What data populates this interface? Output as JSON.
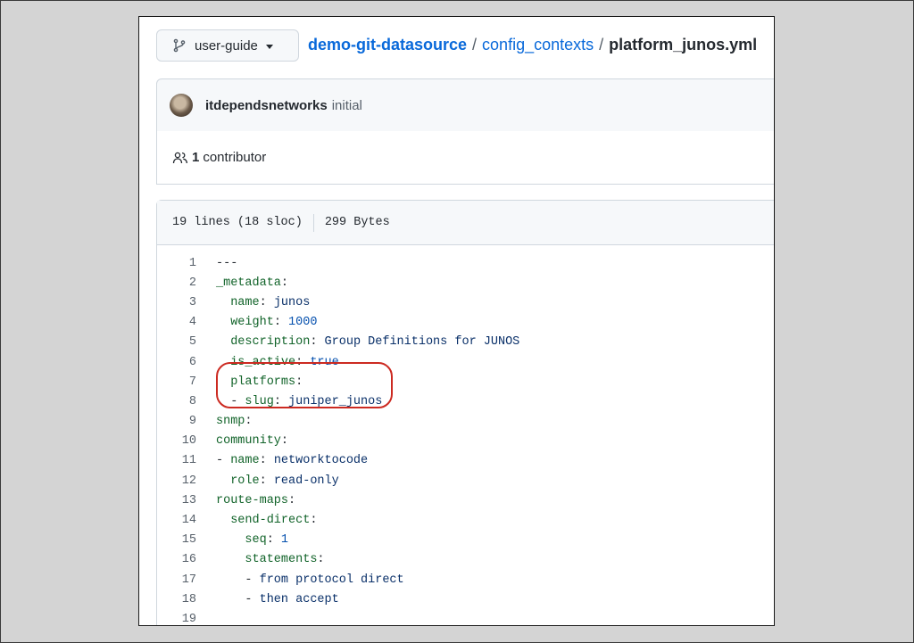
{
  "branch": {
    "label": "user-guide"
  },
  "breadcrumb": {
    "repo": "demo-git-datasource",
    "sep1": "/",
    "folder": "config_contexts",
    "sep2": "/",
    "file": "platform_junos.yml"
  },
  "commit": {
    "author": "itdependsnetworks",
    "message": "initial"
  },
  "contributors": {
    "count": "1",
    "label": "contributor"
  },
  "file_info": {
    "lines": "19 lines (18 sloc)",
    "size": "299 Bytes"
  },
  "code": {
    "lines": [
      {
        "num": "1",
        "indent": "",
        "key": "",
        "colon": "",
        "value": "---",
        "vtype": "p",
        "dash": ""
      },
      {
        "num": "2",
        "indent": "",
        "key": "_metadata",
        "colon": ":",
        "value": "",
        "vtype": "v",
        "dash": ""
      },
      {
        "num": "3",
        "indent": "  ",
        "key": "name",
        "colon": ":",
        "value": " junos",
        "vtype": "v",
        "dash": ""
      },
      {
        "num": "4",
        "indent": "  ",
        "key": "weight",
        "colon": ":",
        "value": " 1000",
        "vtype": "n",
        "dash": ""
      },
      {
        "num": "5",
        "indent": "  ",
        "key": "description",
        "colon": ":",
        "value": " Group Definitions for JUNOS",
        "vtype": "v",
        "dash": ""
      },
      {
        "num": "6",
        "indent": "  ",
        "key": "is_active",
        "colon": ":",
        "value": " true",
        "vtype": "n",
        "dash": ""
      },
      {
        "num": "7",
        "indent": "  ",
        "key": "platforms",
        "colon": ":",
        "value": "",
        "vtype": "v",
        "dash": ""
      },
      {
        "num": "8",
        "indent": "  ",
        "key": "slug",
        "colon": ":",
        "value": " juniper_junos",
        "vtype": "v",
        "dash": "- "
      },
      {
        "num": "9",
        "indent": "",
        "key": "snmp",
        "colon": ":",
        "value": "",
        "vtype": "v",
        "dash": ""
      },
      {
        "num": "10",
        "indent": "",
        "key": "community",
        "colon": ":",
        "value": "",
        "vtype": "v",
        "dash": ""
      },
      {
        "num": "11",
        "indent": "",
        "key": "name",
        "colon": ":",
        "value": " networktocode",
        "vtype": "v",
        "dash": "- "
      },
      {
        "num": "12",
        "indent": "  ",
        "key": "role",
        "colon": ":",
        "value": " read-only",
        "vtype": "v",
        "dash": ""
      },
      {
        "num": "13",
        "indent": "",
        "key": "route-maps",
        "colon": ":",
        "value": "",
        "vtype": "v",
        "dash": ""
      },
      {
        "num": "14",
        "indent": "  ",
        "key": "send-direct",
        "colon": ":",
        "value": "",
        "vtype": "v",
        "dash": ""
      },
      {
        "num": "15",
        "indent": "    ",
        "key": "seq",
        "colon": ":",
        "value": " 1",
        "vtype": "n",
        "dash": ""
      },
      {
        "num": "16",
        "indent": "    ",
        "key": "statements",
        "colon": ":",
        "value": "",
        "vtype": "v",
        "dash": ""
      },
      {
        "num": "17",
        "indent": "    ",
        "key": "",
        "colon": "",
        "value": "from protocol direct",
        "vtype": "v",
        "dash": "- "
      },
      {
        "num": "18",
        "indent": "    ",
        "key": "",
        "colon": "",
        "value": "then accept",
        "vtype": "v",
        "dash": "- "
      },
      {
        "num": "19",
        "indent": "",
        "key": "",
        "colon": "",
        "value": "",
        "vtype": "v",
        "dash": ""
      }
    ]
  },
  "colors": {
    "link": "#0969da",
    "yaml_key": "#116329",
    "yaml_string": "#0a3069",
    "yaml_number": "#0550ae",
    "annotation_ring": "#cc2a21"
  },
  "icons": {
    "branch": "git-branch-icon",
    "caret": "caret-down-icon",
    "contributors": "people-icon"
  }
}
